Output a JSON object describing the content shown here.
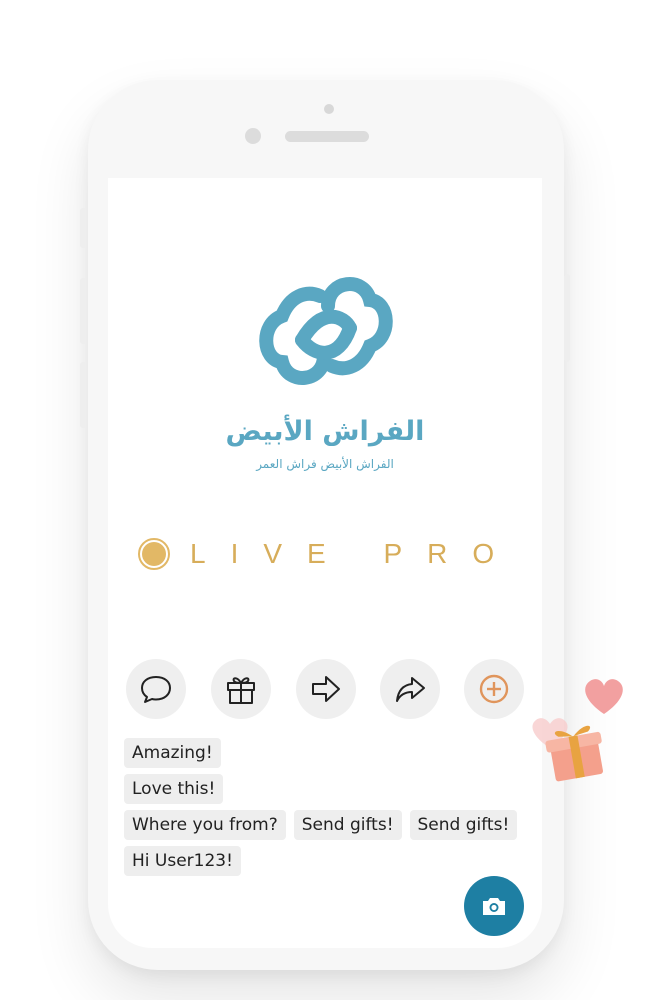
{
  "brand": {
    "title_ar": "الفراش الأبيض",
    "subtitle_ar": "الفراش الأبيض فراش العمر",
    "logo_icon": "cloud-infinity-logo-icon",
    "logo_color": "#5aa7c2"
  },
  "live": {
    "label": "LIVE PRO",
    "accent": "#e2b866"
  },
  "actions": [
    {
      "icon": "chat-bubble-icon"
    },
    {
      "icon": "gift-icon"
    },
    {
      "icon": "arrow-right-icon"
    },
    {
      "icon": "share-icon"
    },
    {
      "icon": "add-circle-icon",
      "color": "#e0955c"
    }
  ],
  "chat": {
    "messages": [
      "Amazing!",
      "Love this!",
      "Where you from?",
      "Send gifts!",
      "Send gifts!",
      "Hi User123!"
    ]
  },
  "camera_button": {
    "icon": "camera-icon",
    "color": "#1e7fa3"
  },
  "decorations": {
    "icons": [
      "heart-icon",
      "heart-icon",
      "gift-box-icon"
    ],
    "heart_color": "#f2a0a0"
  }
}
